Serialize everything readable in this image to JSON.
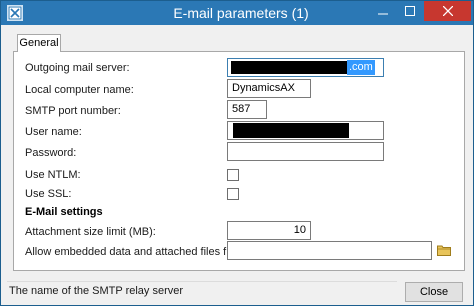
{
  "window": {
    "title": "E-mail parameters (1)",
    "close_glyph": "✕",
    "minimize_glyph": "—",
    "maximize_glyph": "☐"
  },
  "tabs": [
    {
      "label": "General",
      "selected": true
    }
  ],
  "form": {
    "outgoing_mail_server": {
      "label": "Outgoing mail server:",
      "value_visible_suffix": ".com"
    },
    "local_computer_name": {
      "label": "Local computer name:",
      "value": "DynamicsAX"
    },
    "smtp_port_number": {
      "label": "SMTP port number:",
      "value": "587"
    },
    "user_name": {
      "label": "User name:"
    },
    "password": {
      "label": "Password:",
      "value": ""
    },
    "use_ntlm": {
      "label": "Use NTLM:",
      "checked": false
    },
    "use_ssl": {
      "label": "Use SSL:",
      "checked": false
    }
  },
  "email_settings": {
    "heading": "E-Mail settings",
    "attachment_size_limit": {
      "label": "Attachment size limit (MB):",
      "value": "10"
    },
    "allow_embedded": {
      "label": "Allow embedded data and attached files from:",
      "value": ""
    }
  },
  "status": {
    "help_text": "The name of the SMTP relay server"
  },
  "buttons": {
    "close_label": "Close"
  },
  "icons": {
    "app": "dynamics-ax-icon",
    "folder": "folder-icon"
  },
  "colors": {
    "titlebar": "#2b78b5",
    "close_hover": "#c7372f",
    "selection": "#3399ff"
  }
}
